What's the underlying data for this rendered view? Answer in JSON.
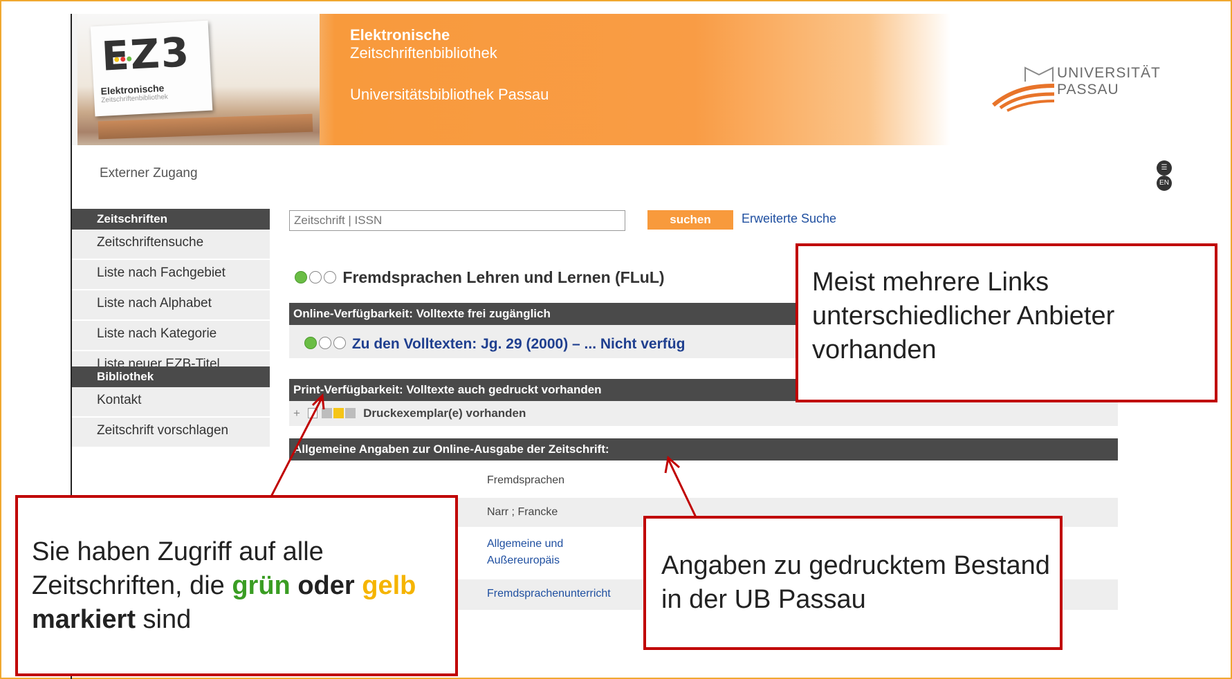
{
  "header": {
    "logo_mark": "EZ3",
    "logo_sub1": "Elektronische",
    "logo_sub2": "Zeitschriftenbibliothek",
    "title_line1": "Elektronische",
    "title_line2": "Zeitschriftenbibliothek",
    "title_line3": "Universitätsbibliothek Passau",
    "uni_logo_line1": "UNIVERSITÄT",
    "uni_logo_line2": "PASSAU"
  },
  "topbar": {
    "external_access": "Externer Zugang",
    "lang_icon_label": "EN",
    "icons": [
      "print-icon",
      "language-icon"
    ]
  },
  "sidebar": {
    "sections": [
      {
        "title": "Zeitschriften",
        "items": [
          {
            "label": "Zeitschriftensuche"
          },
          {
            "label": "Liste nach Fachgebiet"
          },
          {
            "label": "Liste nach Alphabet"
          },
          {
            "label": "Liste nach Kategorie"
          },
          {
            "label": "Liste neuer EZB-Titel"
          }
        ]
      },
      {
        "title": "Bibliothek",
        "items": [
          {
            "label": "Kontakt"
          },
          {
            "label": "Zeitschrift vorschlagen"
          }
        ]
      }
    ]
  },
  "search": {
    "placeholder": "Zeitschrift | ISSN",
    "button_label": "suchen",
    "advanced_link": "Erweiterte Suche"
  },
  "journal": {
    "title": "Fremdsprachen Lehren und Lernen (FLuL)",
    "online_header": "Online-Verfügbarkeit: Volltexte frei zugänglich",
    "fulltext_link": "Zu den Volltexten: Jg. 29 (2000) – ... Nicht verfüg",
    "print_header": "Print-Verfügbarkeit: Volltexte auch gedruckt vorhanden",
    "print_row": "Druckexemplar(e) vorhanden",
    "general_header": "Allgemeine Angaben zur Online-Ausgabe der Zeitschrift:",
    "rows": [
      {
        "value": "Fremdsprachen"
      },
      {
        "value": "Narr ; Francke"
      },
      {
        "value": "Allgemeine und"
      },
      {
        "value": "Außereuropäis"
      },
      {
        "value": "Fremdsprachenunterricht"
      }
    ],
    "traffic_light_colors": {
      "green": "#6abd45",
      "yellow": "#f5c518",
      "gray": "#bdbdbd"
    }
  },
  "callouts": {
    "links": "Meist mehrere Links unterschiedlicher Anbieter vorhanden",
    "access_part1": "Sie haben Zugriff auf alle Zeitschriften, die ",
    "access_green": "grün",
    "access_part2": " oder ",
    "access_yellow": "gelb",
    "access_part3": " markiert",
    "access_part4": " sind",
    "print": "Angaben zu gedrucktem Bestand in der UB Passau"
  },
  "colors": {
    "accent_orange": "#f89a3c",
    "callout_border": "#c00000",
    "frame_border": "#f0a830",
    "dark_bar": "#4a4a4a",
    "link_blue": "#1f4fa0"
  }
}
